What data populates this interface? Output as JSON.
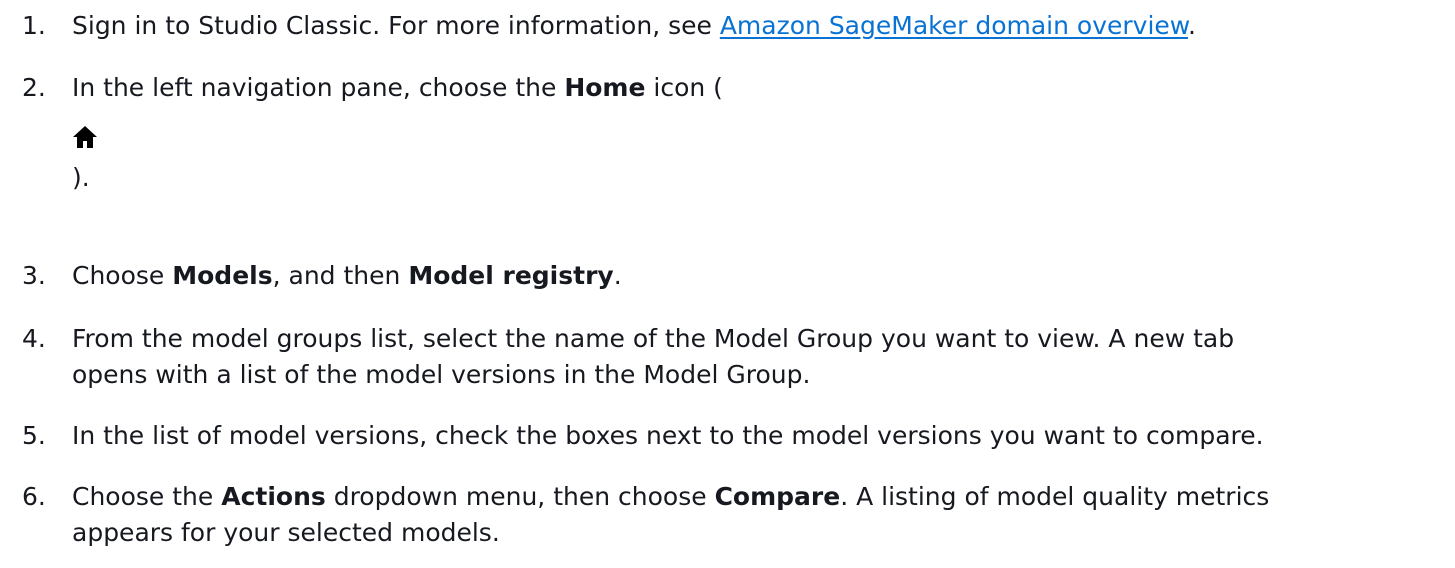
{
  "steps": [
    {
      "number": "1.",
      "lead": "Sign in to Studio Classic. For more information, see ",
      "link": "Amazon SageMaker domain overview",
      "tail": "."
    },
    {
      "number": "2.",
      "lead": "In the left navigation pane, choose the ",
      "bold": "Home",
      "tail": " icon (",
      "icon": "home-icon",
      "close": ")."
    },
    {
      "number": "3.",
      "lead": "Choose ",
      "bold1": "Models",
      "mid": ", and then ",
      "bold2": "Model registry",
      "tail": "."
    },
    {
      "number": "4.",
      "line1": "From the model groups list, select the name of the Model Group you want to view. A new tab",
      "line2": "opens with a list of the model versions in the Model Group."
    },
    {
      "number": "5.",
      "text": "In the list of model versions, check the boxes next to the model versions you want to compare."
    },
    {
      "number": "6.",
      "lead": "Choose the ",
      "bold1": "Actions",
      "mid": " dropdown menu, then choose ",
      "bold2": "Compare",
      "tail": ". A listing of model quality metrics",
      "line2": "appears for your selected models."
    }
  ],
  "colors": {
    "text": "#16191f",
    "link": "#0972d3"
  }
}
